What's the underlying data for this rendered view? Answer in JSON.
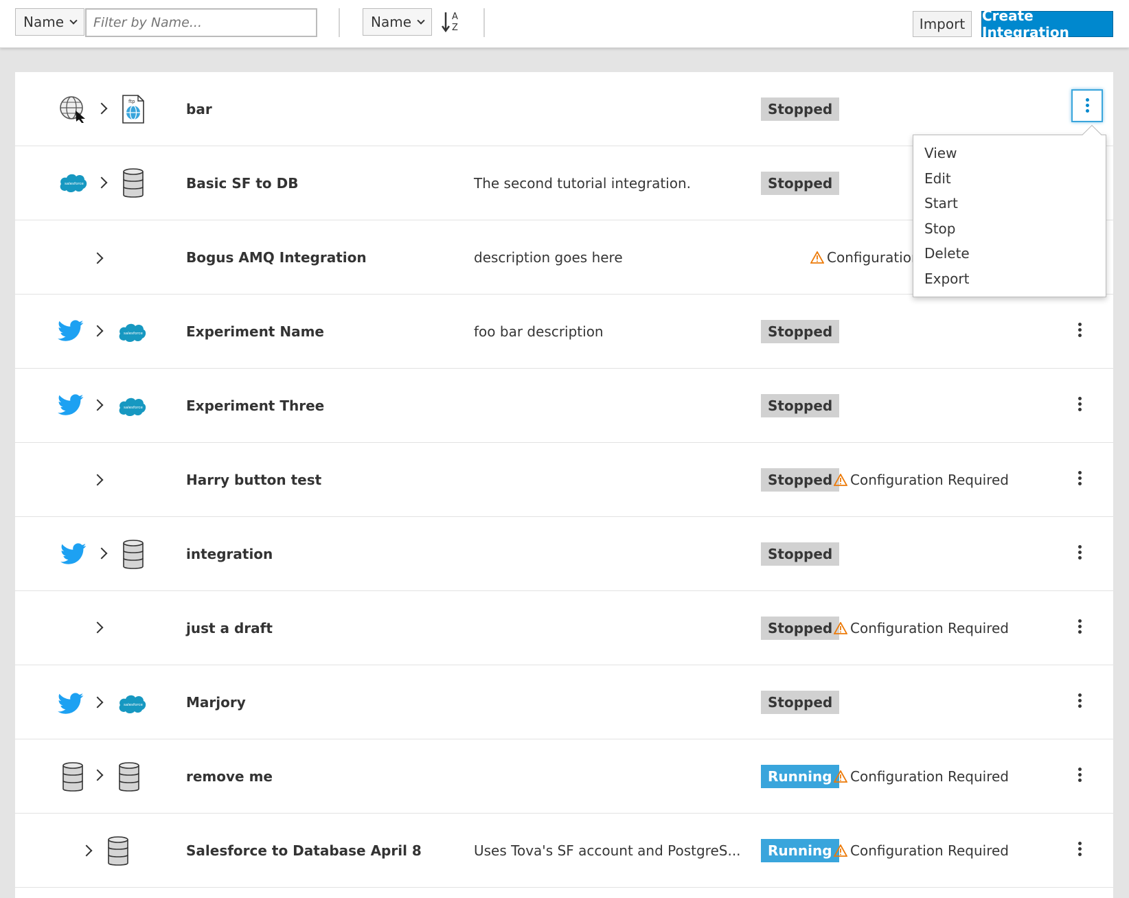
{
  "toolbar": {
    "filter_field": "Name",
    "filter_placeholder": "Filter by Name...",
    "sort_field": "Name",
    "sort_icon": "sort-alpha-asc-icon",
    "import_label": "Import",
    "create_label": "Create Integration"
  },
  "dropdown": {
    "items": [
      "View",
      "Edit",
      "Start",
      "Stop",
      "Delete",
      "Export"
    ]
  },
  "integrations": [
    {
      "name": "bar",
      "description": "",
      "status": "Stopped",
      "warning": "",
      "start_icon": "webhook-globe-icon",
      "end_icon": "ftp-icon"
    },
    {
      "name": "Basic SF to DB",
      "description": "The second tutorial integration.",
      "status": "Stopped",
      "warning": "",
      "start_icon": "salesforce-icon",
      "end_icon": "database-icon"
    },
    {
      "name": "Bogus AMQ Integration",
      "description": "description goes here",
      "status": "",
      "warning": "Configuration",
      "start_icon": "",
      "end_icon": ""
    },
    {
      "name": "Experiment Name",
      "description": "foo bar description",
      "status": "Stopped",
      "warning": "",
      "start_icon": "twitter-icon",
      "end_icon": "salesforce-icon"
    },
    {
      "name": "Experiment Three",
      "description": "",
      "status": "Stopped",
      "warning": "",
      "start_icon": "twitter-icon",
      "end_icon": "salesforce-icon"
    },
    {
      "name": "Harry button test",
      "description": "",
      "status": "Stopped",
      "warning": "Configuration Required",
      "start_icon": "",
      "end_icon": ""
    },
    {
      "name": "integration",
      "description": "",
      "status": "Stopped",
      "warning": "",
      "start_icon": "twitter-icon",
      "end_icon": "database-icon"
    },
    {
      "name": "just a draft",
      "description": "",
      "status": "Stopped",
      "warning": "Configuration Required",
      "start_icon": "",
      "end_icon": ""
    },
    {
      "name": "Marjory",
      "description": "",
      "status": "Stopped",
      "warning": "",
      "start_icon": "twitter-icon",
      "end_icon": "salesforce-icon"
    },
    {
      "name": "remove me",
      "description": "",
      "status": "Running",
      "warning": "Configuration Required",
      "start_icon": "database-icon",
      "end_icon": "database-icon"
    },
    {
      "name": "Salesforce to Database April 8",
      "description": "Uses Tova's SF account and PostgreS...",
      "status": "Running",
      "warning": "Configuration Required",
      "start_icon": "",
      "end_icon": "database-icon"
    }
  ],
  "salesforce_label": "salesforce",
  "ftp_label": "ftp",
  "colors": {
    "primary": "#0088ce",
    "running": "#39a5dc",
    "stopped": "#d1d1d1",
    "warning": "#ec7a08",
    "twitter": "#1da1f2",
    "salesforce": "#1798c1"
  }
}
